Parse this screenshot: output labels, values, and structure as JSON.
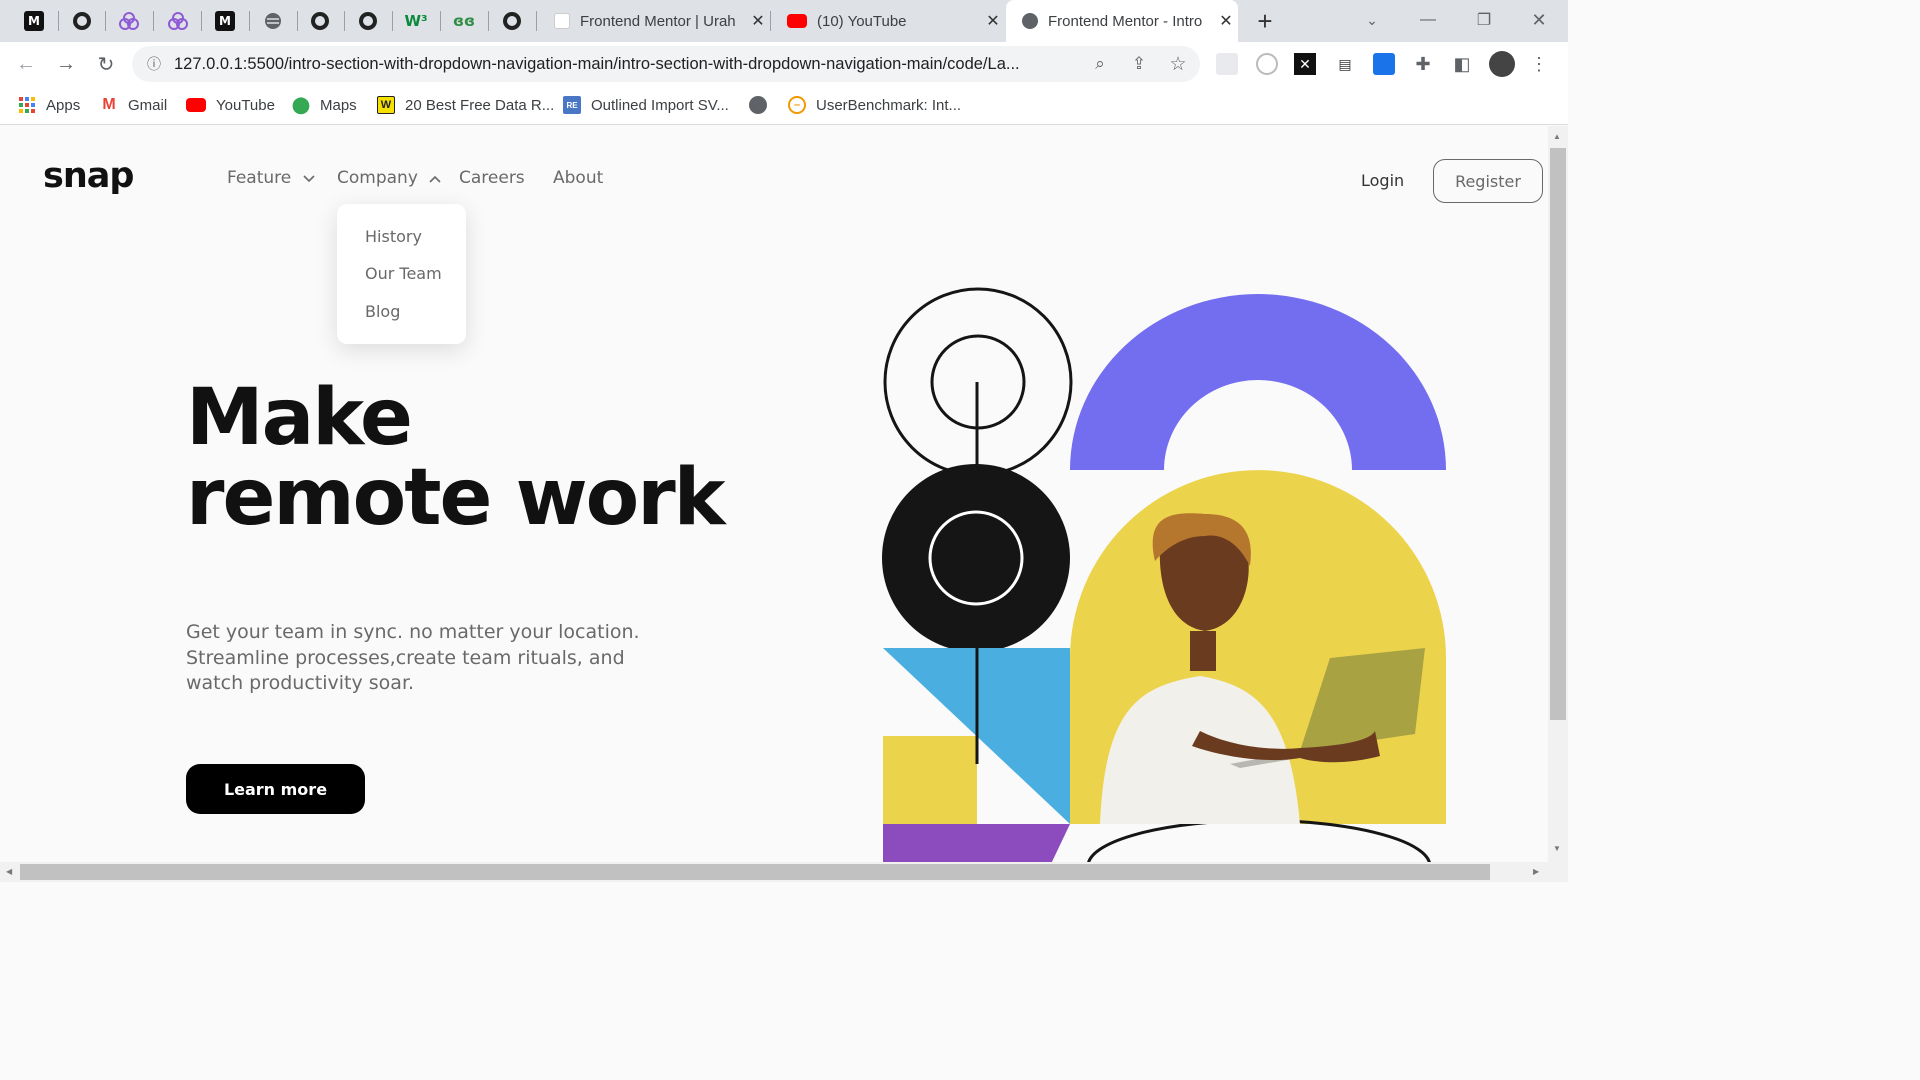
{
  "browser": {
    "tabs": [
      {
        "title": "Frontend Mentor | Urah"
      },
      {
        "title": "(10) YouTube"
      },
      {
        "title": "Frontend Mentor - Intro"
      }
    ],
    "new_tab": "+",
    "url": "127.0.0.1:5500/intro-section-with-dropdown-navigation-main/intro-section-with-dropdown-navigation-main/code/La...",
    "bookmarks": [
      {
        "label": "Apps"
      },
      {
        "label": "Gmail"
      },
      {
        "label": "YouTube"
      },
      {
        "label": "Maps"
      },
      {
        "label": "20 Best Free Data R..."
      },
      {
        "label": "Outlined Import SV..."
      },
      {
        "label": "UserBenchmark: Int..."
      }
    ]
  },
  "site": {
    "logo": "snap",
    "nav": [
      {
        "label": "Feature",
        "chevron": "down"
      },
      {
        "label": "Company",
        "chevron": "up"
      },
      {
        "label": "Careers"
      },
      {
        "label": "About"
      }
    ],
    "dropdown": [
      "History",
      "Our Team",
      "Blog"
    ],
    "login": "Login",
    "register": "Register",
    "headline_line1": "Make",
    "headline_line2": "remote work",
    "subtext": "Get your team in sync. no matter your location. Streamline processes,create team rituals, and watch productivity soar.",
    "cta": "Learn more"
  },
  "colors": {
    "purple": "#736df0",
    "yellow": "#ecd34c",
    "blue": "#4aaee0",
    "violet": "#8d4cbd",
    "black": "#151515"
  }
}
